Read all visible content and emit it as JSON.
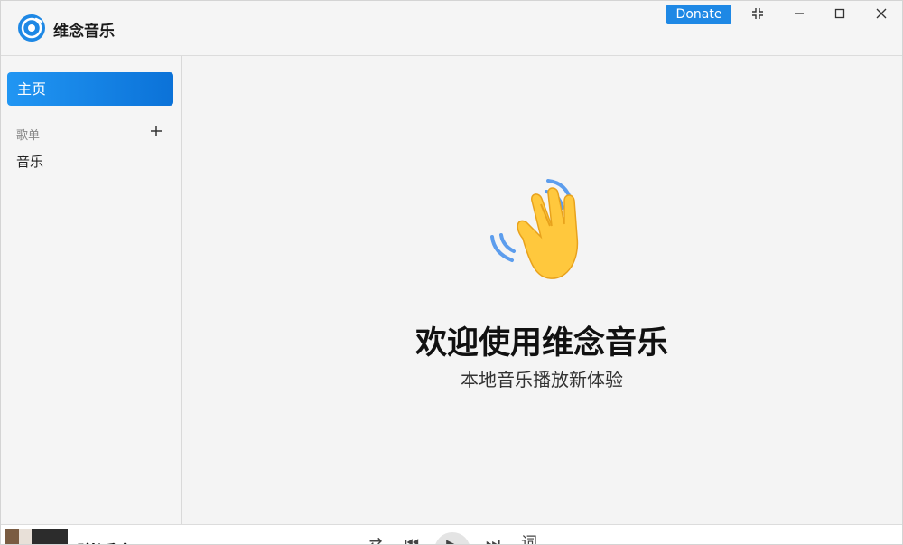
{
  "app": {
    "title": "维念音乐",
    "accent": "#1e88e5"
  },
  "titlebar": {
    "donate_label": "Donate",
    "icons": [
      "restore-icon",
      "minimize-icon",
      "maximize-icon",
      "close-icon"
    ]
  },
  "sidebar": {
    "home_label": "主页",
    "section_label": "歌单",
    "add_icon": "plus-icon",
    "playlists": [
      {
        "label": "音乐"
      }
    ]
  },
  "main": {
    "icon": "waving-hand",
    "welcome_title": "欢迎使用维念音乐",
    "subtitle": "本地音乐播放新体验"
  },
  "player": {
    "song_title": "附近名"
  }
}
